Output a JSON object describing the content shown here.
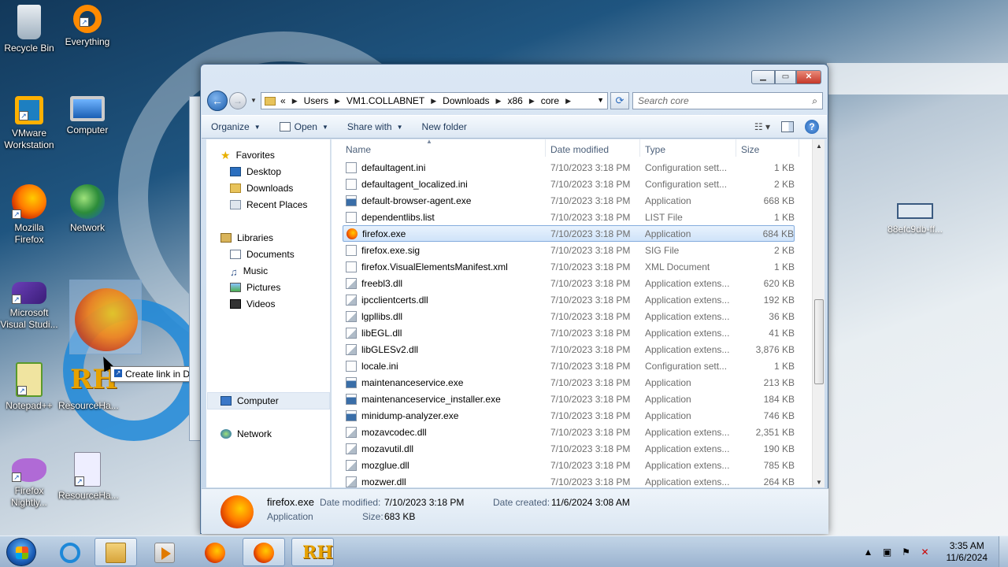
{
  "desktop": {
    "icons": [
      {
        "label": "Recycle Bin"
      },
      {
        "label": "Everything"
      },
      {
        "label": "VMware Workstation"
      },
      {
        "label": "Computer"
      },
      {
        "label": "Mozilla Firefox"
      },
      {
        "label": "Network"
      },
      {
        "label": "Microsoft Visual Studi..."
      },
      {
        "label": "Notepad++"
      },
      {
        "label": "ResourceHa..."
      },
      {
        "label": "Firefox Nightly..."
      },
      {
        "label": "ResourceHa..."
      }
    ],
    "right_icon_label": "88efc9db-ff...",
    "drag_tooltip": "Create link in Desktop"
  },
  "explorer": {
    "breadcrumb": [
      "Users",
      "VM1.COLLABNET",
      "Downloads",
      "x86",
      "core"
    ],
    "breadcrumb_overflow": "«",
    "search_placeholder": "Search core",
    "toolbar": {
      "organize": "Organize",
      "open": "Open",
      "share_with": "Share with",
      "new_folder": "New folder"
    },
    "nav": {
      "favorites": "Favorites",
      "desktop": "Desktop",
      "downloads": "Downloads",
      "recent_places": "Recent Places",
      "libraries": "Libraries",
      "documents": "Documents",
      "music": "Music",
      "pictures": "Pictures",
      "videos": "Videos",
      "computer": "Computer",
      "network": "Network"
    },
    "columns": {
      "name": "Name",
      "date": "Date modified",
      "type": "Type",
      "size": "Size"
    },
    "files": [
      {
        "name": "defaultagent.ini",
        "date": "7/10/2023 3:18 PM",
        "type": "Configuration sett...",
        "size": "1 KB",
        "icon": "file-icon"
      },
      {
        "name": "defaultagent_localized.ini",
        "date": "7/10/2023 3:18 PM",
        "type": "Configuration sett...",
        "size": "2 KB",
        "icon": "file-icon"
      },
      {
        "name": "default-browser-agent.exe",
        "date": "7/10/2023 3:18 PM",
        "type": "Application",
        "size": "668 KB",
        "icon": "exe-icon"
      },
      {
        "name": "dependentlibs.list",
        "date": "7/10/2023 3:18 PM",
        "type": "LIST File",
        "size": "1 KB",
        "icon": "file-icon"
      },
      {
        "name": "firefox.exe",
        "date": "7/10/2023 3:18 PM",
        "type": "Application",
        "size": "684 KB",
        "icon": "firefox-icon",
        "selected": true
      },
      {
        "name": "firefox.exe.sig",
        "date": "7/10/2023 3:18 PM",
        "type": "SIG File",
        "size": "2 KB",
        "icon": "file-icon"
      },
      {
        "name": "firefox.VisualElementsManifest.xml",
        "date": "7/10/2023 3:18 PM",
        "type": "XML Document",
        "size": "1 KB",
        "icon": "file-icon"
      },
      {
        "name": "freebl3.dll",
        "date": "7/10/2023 3:18 PM",
        "type": "Application extens...",
        "size": "620 KB",
        "icon": "dll-icon"
      },
      {
        "name": "ipcclientcerts.dll",
        "date": "7/10/2023 3:18 PM",
        "type": "Application extens...",
        "size": "192 KB",
        "icon": "dll-icon"
      },
      {
        "name": "lgpllibs.dll",
        "date": "7/10/2023 3:18 PM",
        "type": "Application extens...",
        "size": "36 KB",
        "icon": "dll-icon"
      },
      {
        "name": "libEGL.dll",
        "date": "7/10/2023 3:18 PM",
        "type": "Application extens...",
        "size": "41 KB",
        "icon": "dll-icon"
      },
      {
        "name": "libGLESv2.dll",
        "date": "7/10/2023 3:18 PM",
        "type": "Application extens...",
        "size": "3,876 KB",
        "icon": "dll-icon"
      },
      {
        "name": "locale.ini",
        "date": "7/10/2023 3:18 PM",
        "type": "Configuration sett...",
        "size": "1 KB",
        "icon": "file-icon"
      },
      {
        "name": "maintenanceservice.exe",
        "date": "7/10/2023 3:18 PM",
        "type": "Application",
        "size": "213 KB",
        "icon": "exe-icon"
      },
      {
        "name": "maintenanceservice_installer.exe",
        "date": "7/10/2023 3:18 PM",
        "type": "Application",
        "size": "184 KB",
        "icon": "exe-icon"
      },
      {
        "name": "minidump-analyzer.exe",
        "date": "7/10/2023 3:18 PM",
        "type": "Application",
        "size": "746 KB",
        "icon": "exe-icon"
      },
      {
        "name": "mozavcodec.dll",
        "date": "7/10/2023 3:18 PM",
        "type": "Application extens...",
        "size": "2,351 KB",
        "icon": "dll-icon"
      },
      {
        "name": "mozavutil.dll",
        "date": "7/10/2023 3:18 PM",
        "type": "Application extens...",
        "size": "190 KB",
        "icon": "dll-icon"
      },
      {
        "name": "mozglue.dll",
        "date": "7/10/2023 3:18 PM",
        "type": "Application extens...",
        "size": "785 KB",
        "icon": "dll-icon"
      },
      {
        "name": "mozwer.dll",
        "date": "7/10/2023 3:18 PM",
        "type": "Application extens...",
        "size": "264 KB",
        "icon": "dll-icon"
      }
    ],
    "details": {
      "name": "firefox.exe",
      "type": "Application",
      "date_modified_label": "Date modified:",
      "date_modified": "7/10/2023 3:18 PM",
      "date_created_label": "Date created:",
      "date_created": "11/6/2024 3:08 AM",
      "size_label": "Size:",
      "size": "683 KB"
    }
  },
  "taskbar": {
    "time": "3:35 AM",
    "date": "11/6/2024"
  }
}
